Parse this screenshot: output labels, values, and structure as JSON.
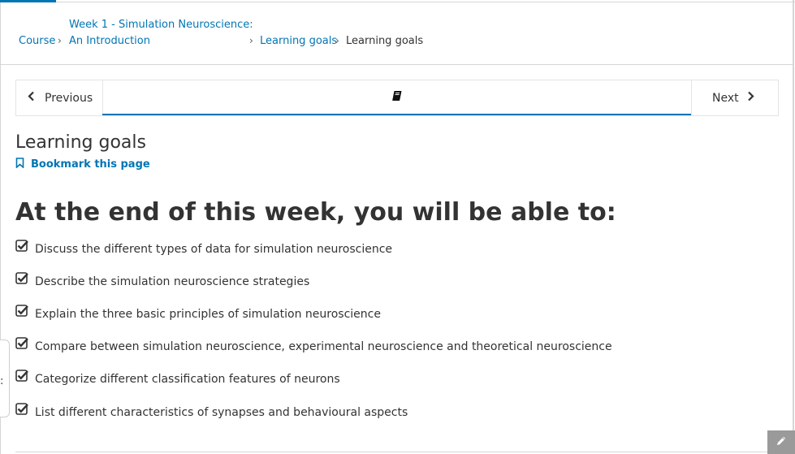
{
  "breadcrumb": {
    "course": "Course",
    "week_line1": "Week 1 - Simulation Neuroscience:",
    "week_line2": "An Introduction",
    "section": "Learning goals",
    "current": "Learning goals"
  },
  "sequence_nav": {
    "previous_label": "Previous",
    "next_label": "Next",
    "active_tab_icon": "book-icon"
  },
  "unit": {
    "title": "Learning goals",
    "bookmark_label": "Bookmark this page"
  },
  "content": {
    "heading": "At the end of this week, you will be able to:",
    "goals": [
      "Discuss the different types of data for simulation neuroscience",
      "Describe the simulation neuroscience strategies",
      "Explain the three basic principles of simulation neuroscience",
      "Compare between simulation neuroscience, experimental neuroscience and theoretical neuroscience",
      "Categorize different classification features of neurons",
      "List different characteristics of synapses and behavioural aspects"
    ]
  },
  "colors": {
    "accent": "#0075b4",
    "text": "#333333",
    "border": "#d6d6d6"
  }
}
